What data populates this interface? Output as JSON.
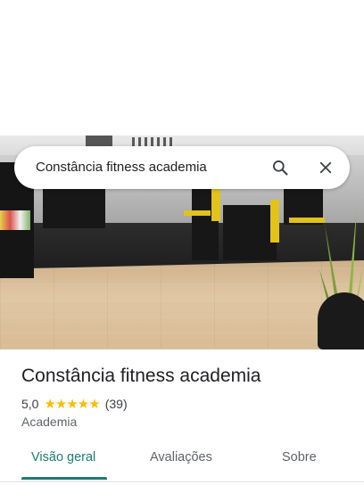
{
  "search": {
    "query": "Constância fitness academia"
  },
  "place": {
    "name": "Constância fitness academia",
    "rating": "5,0",
    "stars": "★★★★★",
    "review_count": "(39)",
    "category": "Academia"
  },
  "tabs": [
    {
      "label": "Visão geral",
      "active": true
    },
    {
      "label": "Avaliações",
      "active": false
    },
    {
      "label": "Sobre",
      "active": false
    }
  ],
  "colors": {
    "accent": "#1a7d73",
    "star": "#fbbc04"
  },
  "icons": [
    "search-icon",
    "close-icon"
  ]
}
